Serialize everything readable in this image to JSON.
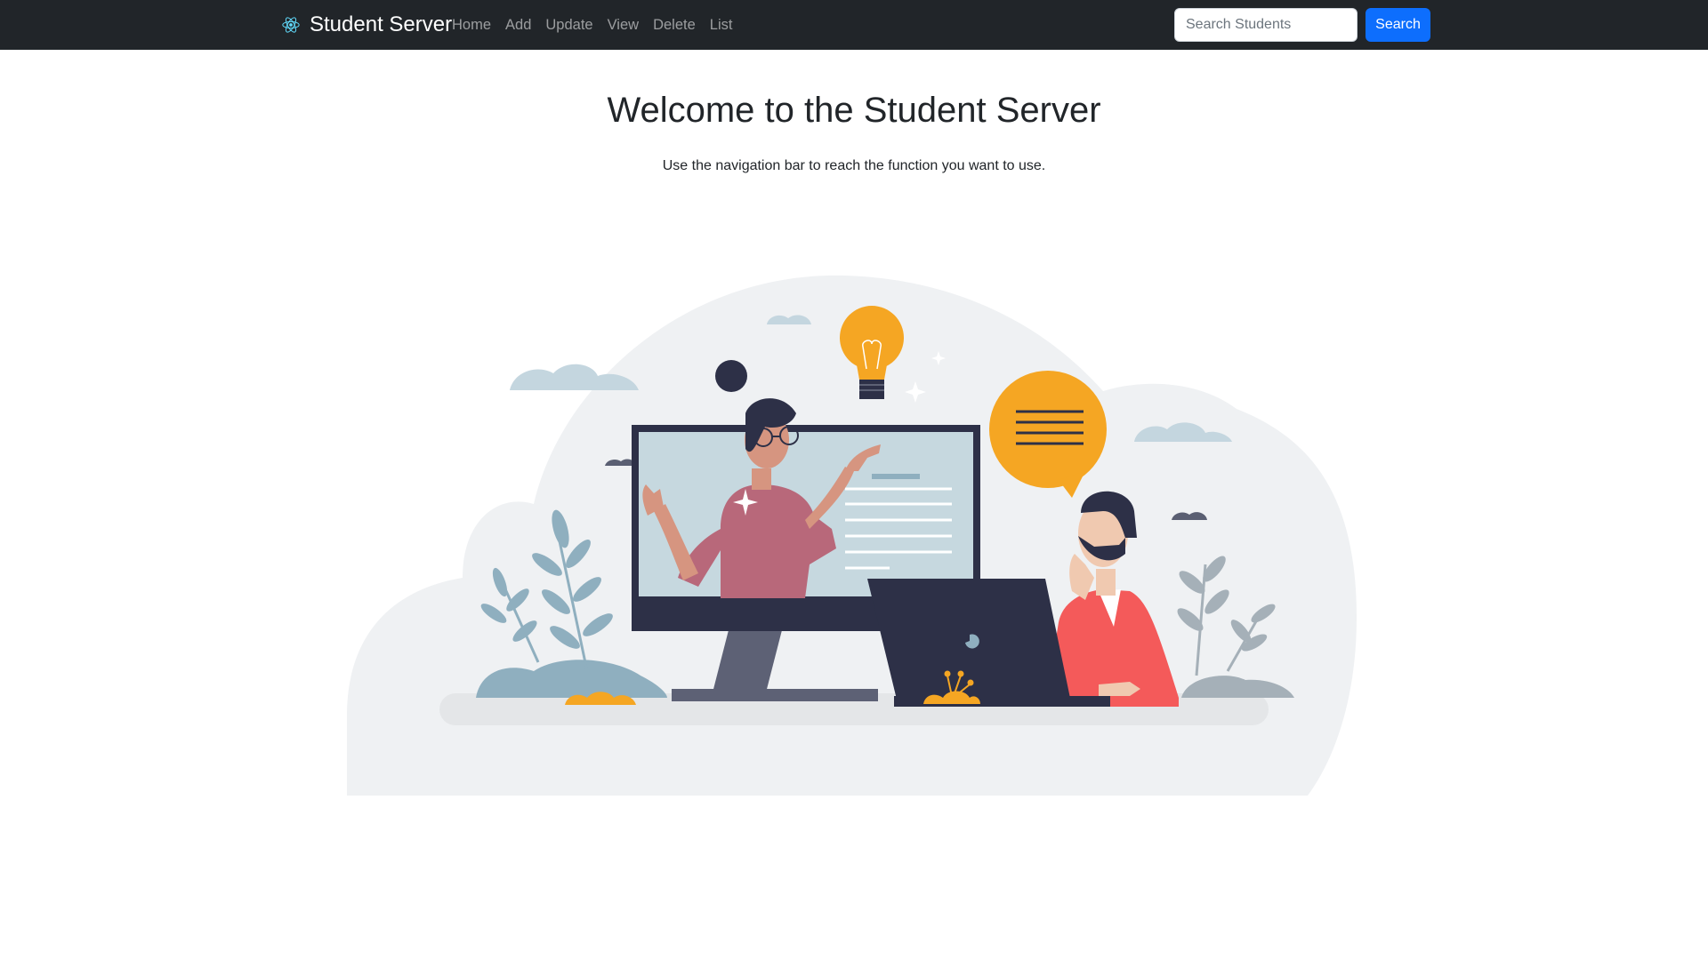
{
  "navbar": {
    "brand": "Student Server",
    "brand_icon": "react-atom-icon",
    "links": [
      "Home",
      "Add",
      "Update",
      "View",
      "Delete",
      "List"
    ],
    "search_placeholder": "Search Students",
    "search_value": "",
    "search_button": "Search"
  },
  "main": {
    "title": "Welcome to the Student Server",
    "subtitle": "Use the navigation bar to reach the function you want to use."
  },
  "colors": {
    "navbar_bg": "#212529",
    "accent": "#0d6efd",
    "illustration_yellow": "#f5a623",
    "illustration_navy": "#2d3047",
    "illustration_pink": "#b8687a",
    "illustration_red": "#f45a5a"
  }
}
